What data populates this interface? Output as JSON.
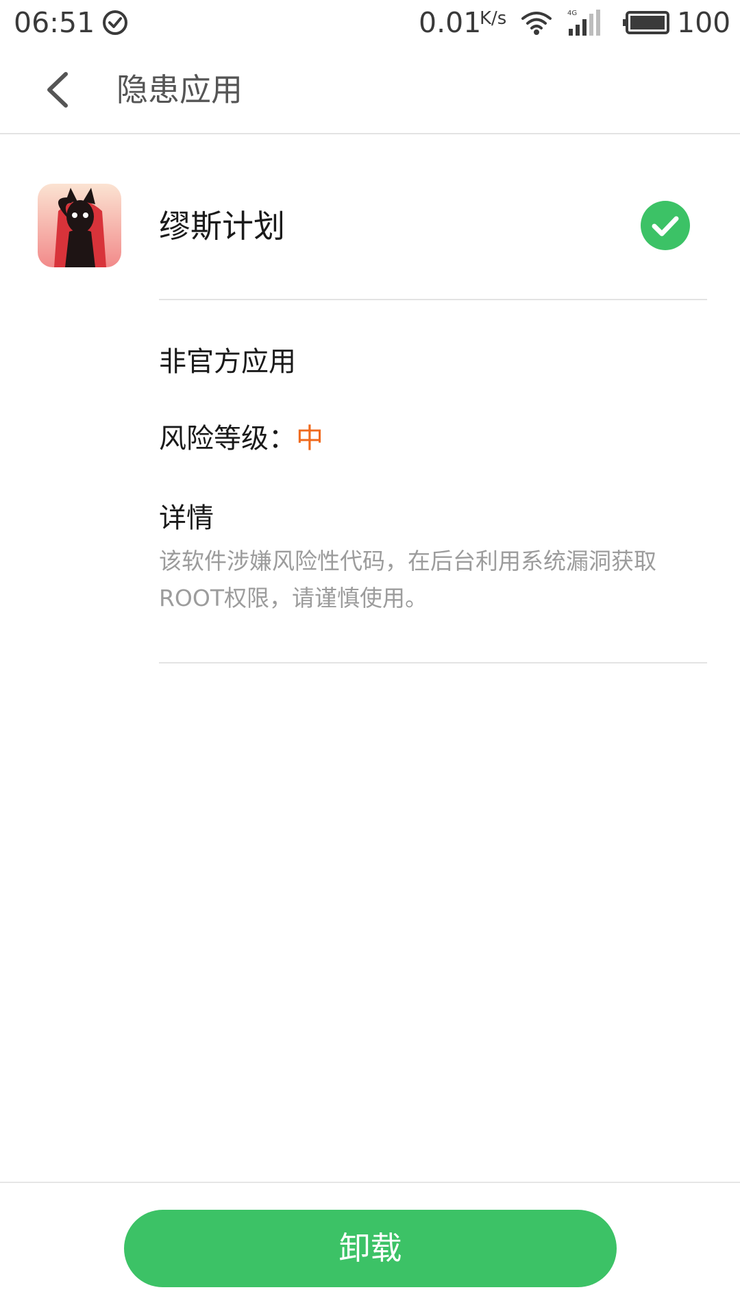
{
  "status_bar": {
    "time": "06:51",
    "net_speed": "0.01",
    "net_unit": "K/s",
    "battery": "100",
    "icons": [
      "check-circle-icon",
      "wifi-icon",
      "signal-4g-icon",
      "battery-icon"
    ]
  },
  "header": {
    "title": "隐患应用",
    "back_icon": "chevron-left-icon"
  },
  "app": {
    "name": "缪斯计划",
    "selected": true,
    "icon": "app-icon-muse-plan"
  },
  "detail": {
    "source_label": "非官方应用",
    "risk_label": "风险等级：",
    "risk_value": "中",
    "details_title": "详情",
    "details_text": "该软件涉嫌风险性代码，在后台利用系统漏洞获取ROOT权限，请谨慎使用。"
  },
  "actions": {
    "uninstall_label": "卸载"
  },
  "colors": {
    "accent_green": "#3cc266",
    "risk_orange": "#f06a1d",
    "secondary_text": "#9c9c9c"
  }
}
